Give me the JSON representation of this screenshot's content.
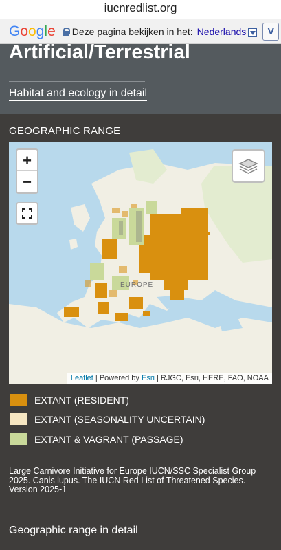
{
  "browser": {
    "url": "iucnredlist.org"
  },
  "translate_bar": {
    "logo": "Google",
    "prompt": "Deze pagina bekijken in het:",
    "language": "Nederlands",
    "button_label": "V"
  },
  "habitat": {
    "title": "Artificial/Terrestrial",
    "link": "Habitat and ecology in detail"
  },
  "range": {
    "title": "GEOGRAPHIC RANGE",
    "map": {
      "zoom_in": "+",
      "zoom_out": "−",
      "place_label": "EUROPE",
      "attribution_leaflet": "Leaflet",
      "attribution_mid": " | Powered by ",
      "attribution_esri": "Esri",
      "attribution_rest": " | RJGC, Esri, HERE, FAO, NOAA",
      "icons": [
        "plus-icon",
        "minus-icon",
        "fullscreen-icon",
        "layers-icon"
      ]
    },
    "legend": [
      {
        "label": "EXTANT (RESIDENT)",
        "color": "#d9900f"
      },
      {
        "label": "EXTANT (SEASONALITY UNCERTAIN)",
        "color": "#f6e6c2"
      },
      {
        "label": "EXTANT & VAGRANT (PASSAGE)",
        "color": "#c9d99a"
      }
    ],
    "citation": "Large Carnivore Initiative for Europe IUCN/SSC Specialist Group 2025. Canis lupus. The IUCN Red List of Threatened Species. Version 2025-1",
    "detail_link": "Geographic range in detail"
  }
}
